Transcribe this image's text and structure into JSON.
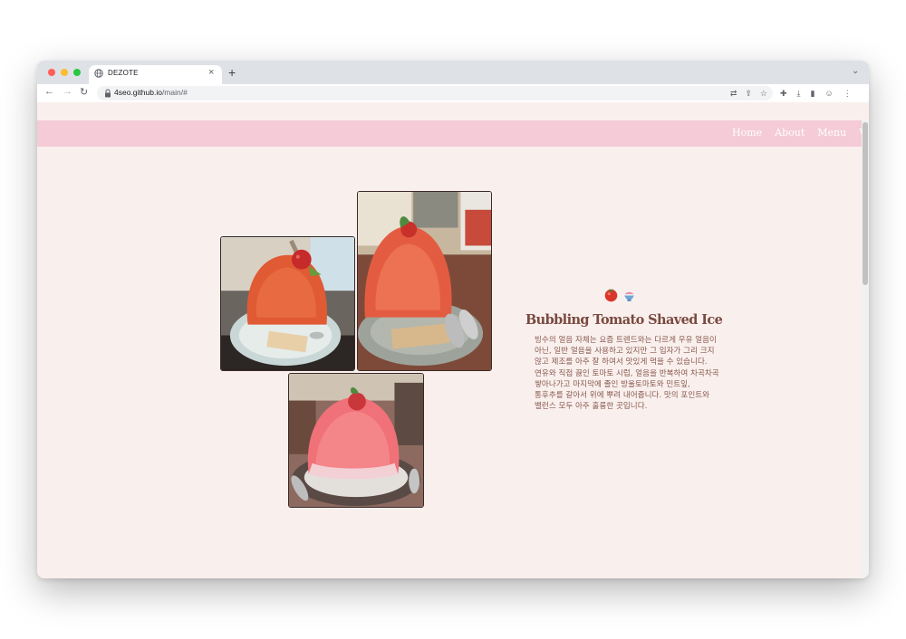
{
  "browser": {
    "tab_title": "DEZOTE",
    "tab_close": "×",
    "new_tab": "+",
    "url_host": "4seo.github.io",
    "url_path": "/main/#",
    "traffic_lights": [
      "#fe5f57",
      "#febc2e",
      "#28c840"
    ]
  },
  "site": {
    "nav": [
      "Home",
      "About",
      "Menu",
      "Wifi"
    ],
    "navbar_color": "#f4cbd6",
    "background_color": "#f9f0ee"
  },
  "dish": {
    "icons": [
      "tomato-emoji",
      "shaved-ice-emoji"
    ],
    "title": "Bubbling Tomato Shaved Ice",
    "description": "빙수의 얼음 자체는 요즘 트렌드와는 다르게 우유 얼음이 아닌, 일반 얼음을 사용하고 있지만 그 입자가 그리 크지 않고 제조를 아주 잘 하여서 맛있게 먹을 수 있습니다. 연유와 직접 끓인 토마토 시럽, 얼음을 반복하여 차곡차곡 쌓아나가고 마지막에 졸인 방울토마토와 민트잎, 통후추를 갈아서 위에 뿌려 내어줍니다. 맛의 포인트와 밸런스 모두 아주 훌륭한 곳입니다.",
    "title_color": "#7a4a3f"
  }
}
